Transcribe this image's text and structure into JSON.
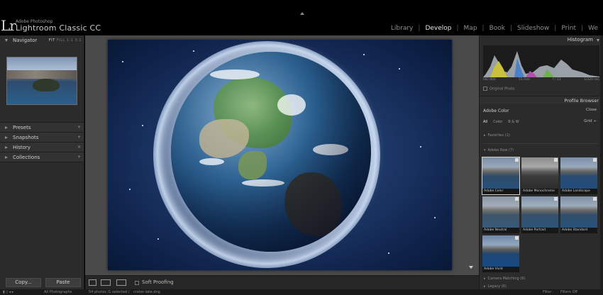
{
  "brand": {
    "logo": "Lr",
    "small": "Adobe Photoshop",
    "big": "Lightroom Classic CC"
  },
  "modules": [
    "Library",
    "Develop",
    "Map",
    "Book",
    "Slideshow",
    "Print",
    "We"
  ],
  "active_module": "Develop",
  "left_panel": {
    "navigator": {
      "label": "Navigator",
      "modes": [
        "FIT",
        "FILL",
        "1:1",
        "3:1"
      ]
    },
    "sections": [
      {
        "label": "Presets",
        "right": "+"
      },
      {
        "label": "Snapshots",
        "right": "+"
      },
      {
        "label": "History",
        "right": "×"
      },
      {
        "label": "Collections",
        "right": "+"
      }
    ],
    "copy_label": "Copy...",
    "paste_label": "Paste"
  },
  "toolbar": {
    "soft_proofing_label": "Soft Proofing"
  },
  "right_panel": {
    "histogram_label": "Histogram",
    "hist_info": [
      "ISO 800",
      "15 mm",
      "f / 11",
      "1/320 sec"
    ],
    "original_photo_label": "Original Photo",
    "profile_browser_label": "Profile Browser",
    "profile_name": "Adobe Color",
    "close_label": "Close",
    "filters": [
      "All",
      "Color",
      "B & W"
    ],
    "active_filter": "All",
    "grid_label": "Grid ÷",
    "groups": {
      "favorites": "Favorites (1)",
      "adobe_raw": "Adobe Raw (7)",
      "camera_matching": "Camera Matching (6)",
      "legacy": "Legacy (6)"
    },
    "profiles": [
      {
        "label": "Adobe Color",
        "selected": true
      },
      {
        "label": "Adobe Monochrome",
        "selected": false
      },
      {
        "label": "Adobe Landscape",
        "selected": false
      },
      {
        "label": "Adobe Neutral",
        "selected": false
      },
      {
        "label": "Adobe Portrait",
        "selected": false
      },
      {
        "label": "Adobe Standard",
        "selected": false
      },
      {
        "label": "Adobe Vivid",
        "selected": false
      }
    ]
  },
  "bottom_bar": {
    "path": "All Photographs",
    "count": "54 photos /1 selected /",
    "filename": "crater-lake.dng",
    "filter_label": "Filter :",
    "filter_value": "Filters Off"
  },
  "colors": {
    "accent": "#e8e8e8",
    "panel_bg": "#2b2b2b",
    "center_bg": "#4a4a4a"
  }
}
